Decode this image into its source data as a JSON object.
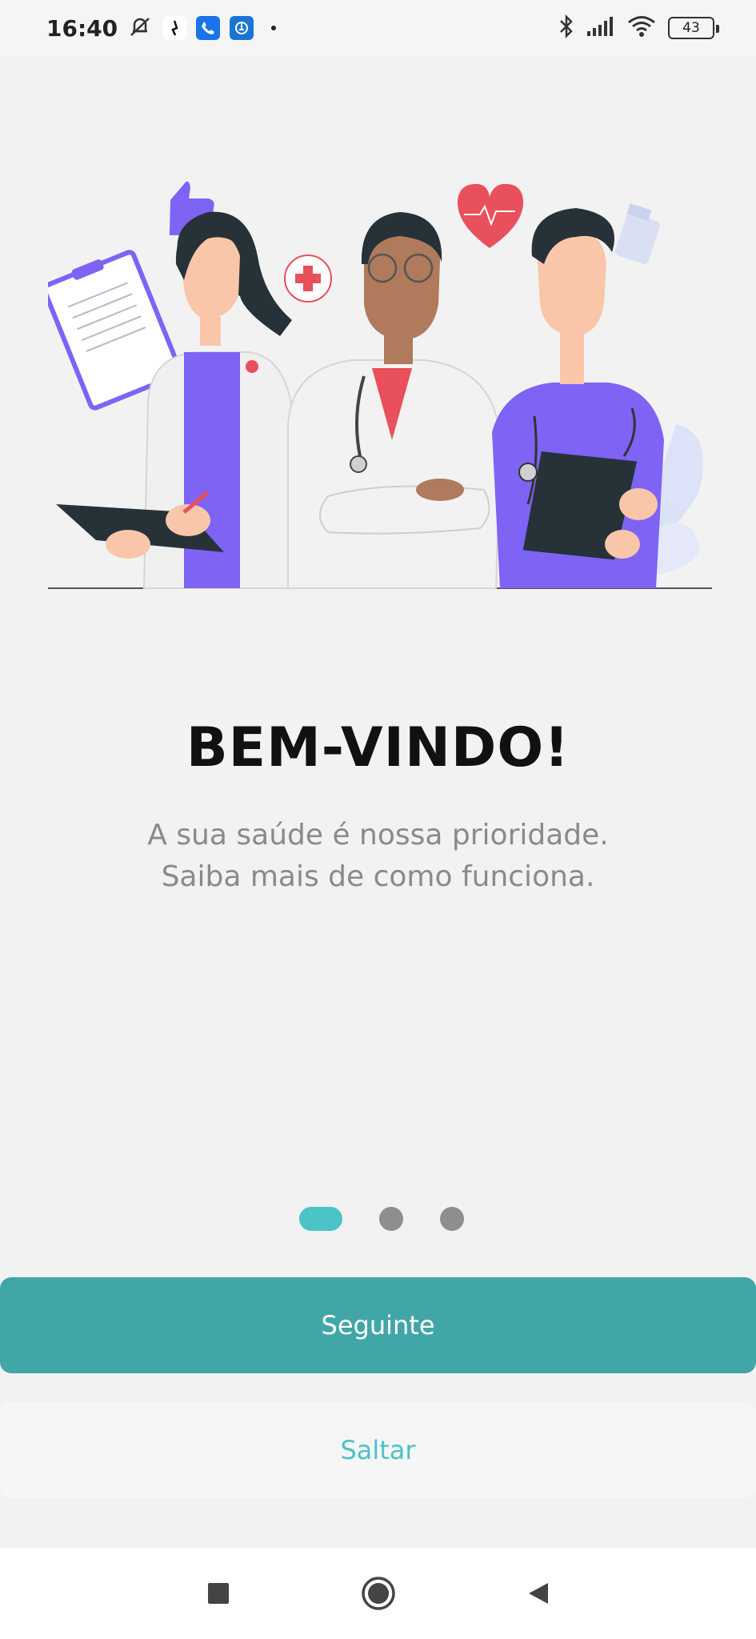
{
  "status_bar": {
    "time": "16:40",
    "battery": "43",
    "icons": [
      "mute-bell-icon",
      "app-notification-icon",
      "phone-icon",
      "app-icon",
      "bluetooth-icon",
      "signal-icon",
      "wifi-icon",
      "battery-icon"
    ]
  },
  "onboarding": {
    "title": "BEM-VINDO!",
    "subtitle_line1": "A sua saúde é nossa prioridade.",
    "subtitle_line2": "Saiba mais de como funciona.",
    "page_count": 3,
    "active_page": 1
  },
  "buttons": {
    "next_label": "Seguinte",
    "skip_label": "Saltar"
  },
  "colors": {
    "primary": "#41a6a8",
    "accent": "#4cc3c6",
    "illustration_purple": "#7e63f5",
    "heart_red": "#e8505b"
  }
}
